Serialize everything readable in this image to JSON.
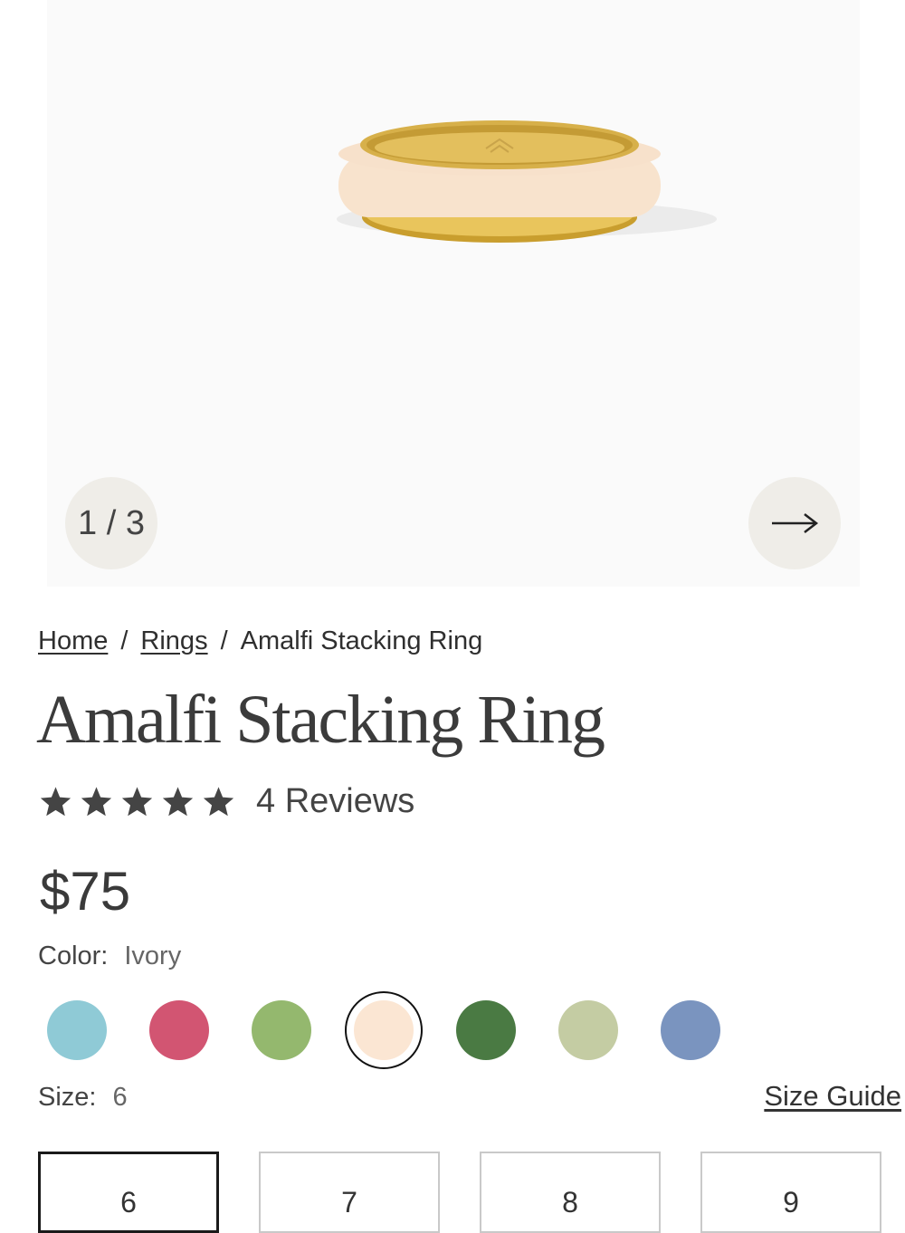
{
  "gallery": {
    "counter": "1 / 3",
    "next_icon": "arrow-right-icon",
    "product_image": "ivory-gold-ring"
  },
  "breadcrumb": {
    "items": [
      "Home",
      "Rings",
      "Amalfi Stacking Ring"
    ],
    "separator": "/"
  },
  "product": {
    "title": "Amalfi Stacking Ring",
    "rating": {
      "stars": 5,
      "max": 5,
      "reviews_label": "4 Reviews"
    },
    "price": "$75"
  },
  "color": {
    "label": "Color:",
    "value": "Ivory",
    "swatches": [
      {
        "name": "light-blue",
        "hex": "#8fcad6"
      },
      {
        "name": "pink",
        "hex": "#d25572"
      },
      {
        "name": "light-green",
        "hex": "#94b86e"
      },
      {
        "name": "ivory",
        "hex": "#fbe6d3",
        "selected": true
      },
      {
        "name": "dark-green",
        "hex": "#4a7a43"
      },
      {
        "name": "sage",
        "hex": "#c4cca3"
      },
      {
        "name": "periwinkle",
        "hex": "#7a94bf"
      }
    ]
  },
  "size": {
    "label": "Size:",
    "value": "6",
    "guide_label": "Size Guide",
    "options": [
      "6",
      "7",
      "8",
      "9"
    ],
    "selected": "6"
  },
  "colors": {
    "text": "#3a3a3a",
    "gallery_bg": "#fafafa",
    "button_bg": "#efede8",
    "ring_gold": "#d6b24a"
  }
}
